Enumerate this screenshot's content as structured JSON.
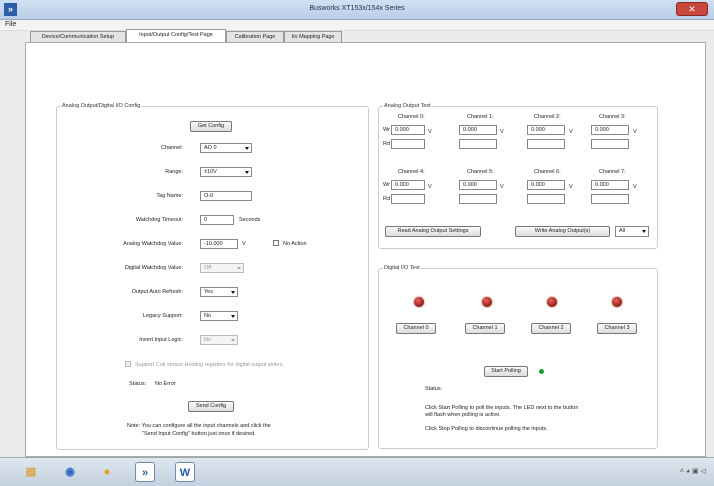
{
  "window": {
    "title": "Busworks XT153x/154x Series",
    "app_icon": "»",
    "close_glyph": "✕"
  },
  "menu": {
    "file": "File"
  },
  "tabs": [
    {
      "label": "Device/Communication Setup"
    },
    {
      "label": "Input/Output Config/Test Page"
    },
    {
      "label": "Calibration Page"
    },
    {
      "label": "I/o Mapping Page"
    }
  ],
  "config": {
    "group_title": "Analog Output/Digital I/O Config",
    "get_config": "Get Config",
    "channel_label": "Channel:",
    "channel_value": "AO 0",
    "range_label": "Range:",
    "range_value": "±10V",
    "tag_label": "Tag Name:",
    "tag_value": "O-0",
    "watchdog_timeout_label": "Watchdog Timeout:",
    "watchdog_timeout_value": "0",
    "watchdog_timeout_unit": "Seconds",
    "analog_watchdog_label": "Analog Watchdog Value:",
    "analog_watchdog_value": "-10.000",
    "analog_watchdog_unit": "V",
    "no_action_label": "No Action",
    "digital_watchdog_label": "Digital Watchdog Value:",
    "digital_watchdog_value": "Off",
    "auto_refresh_label": "Output Auto Refresh:",
    "auto_refresh_value": "Yes",
    "legacy_label": "Legacy Support:",
    "legacy_value": "No",
    "invert_label": "Invert Input Logic:",
    "invert_value": "No",
    "coil_support_label": "Support Coil versus Holding registers for digital output writes.",
    "status_label": "Status:",
    "status_value": "No Error",
    "send_config": "Send Config",
    "note_line1": "Note: You can configure all the input channels and click the",
    "note_line2": "\"Send Input Config\" button just once if desired."
  },
  "analog_test": {
    "group_title": "Analog Output Test",
    "wr_label": "Wr",
    "rd_label": "Rd",
    "row1": [
      {
        "name": "Channel 0:",
        "value": "0.000",
        "unit": "V"
      },
      {
        "name": "Channel 1:",
        "value": "0.000",
        "unit": "V"
      },
      {
        "name": "Channel 2:",
        "value": "0.000",
        "unit": "V"
      },
      {
        "name": "Channel 3:",
        "value": "0.000",
        "unit": "V"
      }
    ],
    "row2": [
      {
        "name": "Channel 4:",
        "value": "0.000",
        "unit": "V"
      },
      {
        "name": "Channel 5:",
        "value": "0.000",
        "unit": "V"
      },
      {
        "name": "Channel 6:",
        "value": "0.000",
        "unit": "V"
      },
      {
        "name": "Channel 7:",
        "value": "0.000",
        "unit": "V"
      }
    ],
    "read_settings": "Read Analog Output Settings",
    "write_outputs": "Write Analog Output(s)",
    "all_value": "All"
  },
  "digital_test": {
    "group_title": "Digital I/O Test",
    "channels": [
      "Channel 0",
      "Channel 1",
      "Channel 2",
      "Channel 3"
    ],
    "start_polling": "Start Polling",
    "status_label": "Status:",
    "help1": "Click Start Polling to poll the inputs. The LED next to the button",
    "help2": "will flash when polling is active.",
    "help3": "Click Stop Polling to discontinue polling the inputs."
  },
  "taskbar": {
    "items": [
      {
        "icon": "folder-icon",
        "glyph": "▤",
        "color": "#d9a13a"
      },
      {
        "icon": "media-icon",
        "glyph": "◉",
        "color": "#2b6cc4"
      },
      {
        "icon": "chrome-icon",
        "glyph": "●",
        "color": "#e0a01f"
      },
      {
        "icon": "busworks-icon",
        "glyph": "»",
        "color": "#2c5fa8"
      },
      {
        "icon": "word-icon",
        "glyph": "W",
        "color": "#2a57a5"
      }
    ],
    "tray": "˄ ◕ ▣ ◁"
  }
}
